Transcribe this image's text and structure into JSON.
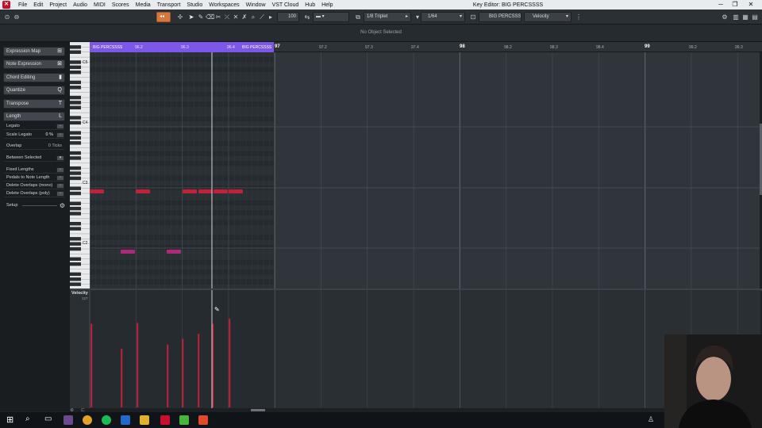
{
  "menubar": {
    "items": [
      "File",
      "Edit",
      "Project",
      "Audio",
      "MIDI",
      "Scores",
      "Media",
      "Transport",
      "Studio",
      "Workspaces",
      "Window",
      "VST Cloud",
      "Hub",
      "Help"
    ],
    "window_title": "Key Editor: BIG PERCSSSS"
  },
  "toolbar": {
    "zoom_value": "100",
    "quantize_value": "1/8 Triplet",
    "length_value": "1/64",
    "track_name": "BIG PERCSSSS",
    "controller_lane": "Velocity"
  },
  "infoline": {
    "message": "No Object Selected"
  },
  "inspector": {
    "sections": [
      {
        "label": "Expression Map",
        "icon": "expression-map-icon"
      },
      {
        "label": "Note Expression",
        "icon": "note-expression-icon"
      },
      {
        "label": "Chord Editing",
        "icon": "chord-editing-icon"
      },
      {
        "label": "Quantize",
        "icon": "quantize-icon"
      },
      {
        "label": "Transpose",
        "icon": "transpose-icon"
      },
      {
        "label": "Length",
        "icon": "length-icon"
      }
    ],
    "length_options": {
      "legato": "Legato",
      "scale_legato": "Scale Legato",
      "scale_legato_value": "0 %",
      "overlap": "Overlap",
      "overlap_value": "0 Ticks",
      "between_selected": "Between Selected",
      "fixed_lengths": "Fixed Lengths",
      "pedals_to_note_length": "Pedals to Note Length",
      "delete_overlaps_mono": "Delete Overlaps (mono)",
      "delete_overlaps_poly": "Delete Overlaps (poly)"
    },
    "setup": "Setup"
  },
  "ruler": {
    "part_label_left": "BIG PERCSSSS",
    "part_label_right": "BIG PERCSSSS",
    "labels": [
      {
        "text": "96.2",
        "bar": false
      },
      {
        "text": "96.3",
        "bar": false
      },
      {
        "text": "96.4",
        "bar": false
      },
      {
        "text": "97",
        "bar": true
      },
      {
        "text": "97.2",
        "bar": false
      },
      {
        "text": "97.3",
        "bar": false
      },
      {
        "text": "97.4",
        "bar": false
      },
      {
        "text": "98",
        "bar": true
      },
      {
        "text": "98.2",
        "bar": false
      },
      {
        "text": "98.3",
        "bar": false
      },
      {
        "text": "98.4",
        "bar": false
      },
      {
        "text": "99",
        "bar": true
      },
      {
        "text": "99.2",
        "bar": false
      },
      {
        "text": "99.3",
        "bar": false
      }
    ]
  },
  "piano": {
    "octave_labels": [
      "C5",
      "C4",
      "C3",
      "C2"
    ]
  },
  "velocity_lane": {
    "title": "Velocity",
    "max_label": "127"
  },
  "colors": {
    "part_range": "#7c57e8",
    "note_red": "#c2213a",
    "note_magenta": "#b0287a",
    "velocity_bar": "#c2213a",
    "playhead": "#cfd4d8"
  }
}
